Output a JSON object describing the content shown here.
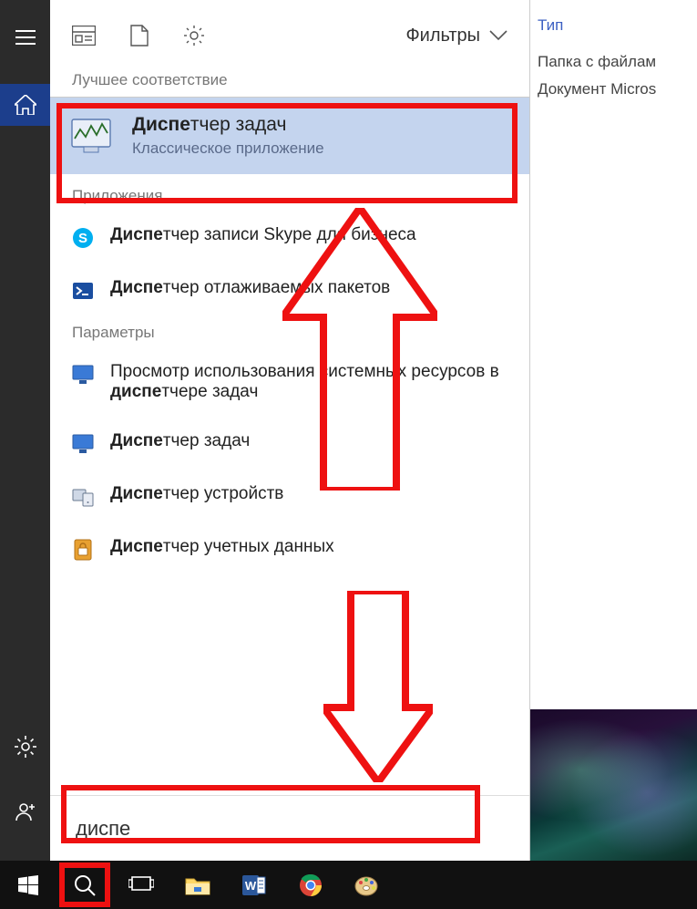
{
  "left_rail": {
    "menu_icon": "menu-icon",
    "home_icon": "home-icon",
    "settings_icon": "settings-icon",
    "person_icon": "person-icon"
  },
  "header": {
    "filters_label": "Фильтры"
  },
  "sections": {
    "best_match": "Лучшее соответствие",
    "apps": "Приложения",
    "settings": "Параметры"
  },
  "best": {
    "match_part": "Диспе",
    "rest_part": "тчер задач",
    "subtitle": "Классическое приложение"
  },
  "apps": [
    {
      "match": "Диспе",
      "rest": "тчер записи Skype для бизнеса",
      "icon": "skype"
    },
    {
      "match": "Диспе",
      "rest": "тчер отлаживаемых пакетов",
      "icon": "powershell"
    }
  ],
  "settings_items": [
    {
      "pre": "Просмотр использования системных ресурсов в ",
      "match": "диспе",
      "post": "тчере задач",
      "icon": "monitor"
    },
    {
      "pre": "",
      "match": "Диспе",
      "post": "тчер задач",
      "icon": "monitor"
    },
    {
      "pre": "",
      "match": "Диспе",
      "post": "тчер устройств",
      "icon": "devices"
    },
    {
      "pre": "",
      "match": "Диспе",
      "post": "тчер учетных данных",
      "icon": "credentials"
    }
  ],
  "search": {
    "value": "диспе"
  },
  "right_peek": {
    "header": "Тип",
    "rows": [
      "Папка с файлам",
      "Документ Micros"
    ]
  }
}
